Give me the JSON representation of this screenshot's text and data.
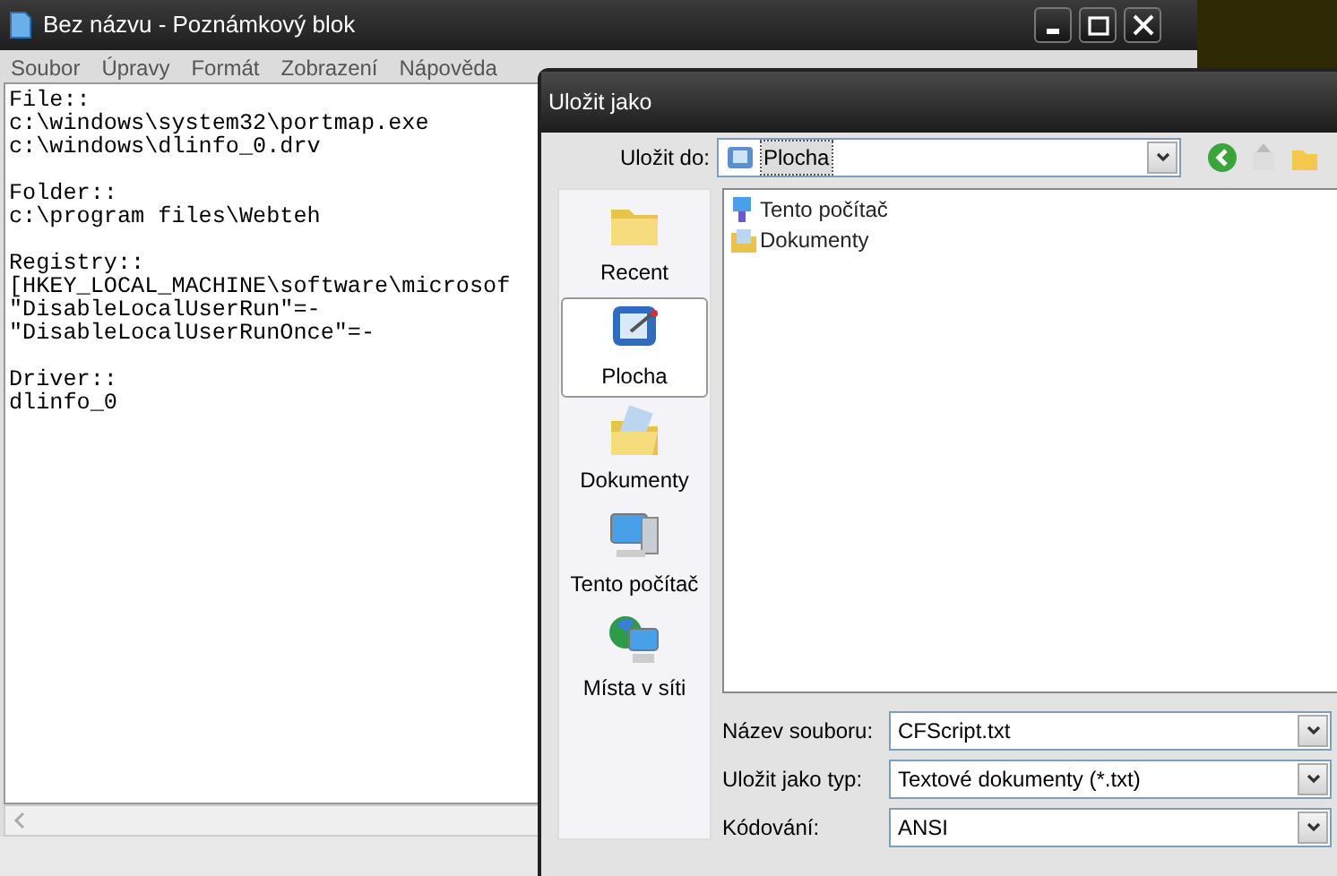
{
  "notepad": {
    "title": "Bez názvu - Poznámkový blok",
    "menu": [
      "Soubor",
      "Úpravy",
      "Formát",
      "Zobrazení",
      "Nápověda"
    ],
    "blocks": [
      [
        "File::",
        "c:\\windows\\system32\\portmap.exe",
        "c:\\windows\\dlinfo_0.drv"
      ],
      [
        "Folder::",
        "c:\\program files\\Webteh"
      ],
      [
        "Registry::",
        "[HKEY_LOCAL_MACHINE\\software\\microsof",
        "\"DisableLocalUserRun\"=-",
        "\"DisableLocalUserRunOnce\"=-"
      ],
      [
        "Driver::",
        "dlinfo_0"
      ]
    ]
  },
  "dialog": {
    "title": "Uložit jako",
    "save_in": {
      "label": "Uložit do:",
      "value": "Plocha"
    },
    "places": [
      {
        "label": "Recent",
        "selected": false
      },
      {
        "label": "Plocha",
        "selected": true
      },
      {
        "label": "Dokumenty",
        "selected": false
      },
      {
        "label": "Tento počítač",
        "selected": false
      },
      {
        "label": "Místa v síti",
        "selected": false
      }
    ],
    "files": [
      {
        "label": "Tento počítač",
        "kind": "computer"
      },
      {
        "label": "Dokumenty",
        "kind": "documents"
      }
    ],
    "fields": [
      {
        "label": "Název souboru:",
        "value": "CFScript.txt"
      },
      {
        "label": "Uložit jako typ:",
        "value": "Textové dokumenty (*.txt)"
      },
      {
        "label": "Kódování:",
        "value": "ANSI"
      }
    ]
  }
}
